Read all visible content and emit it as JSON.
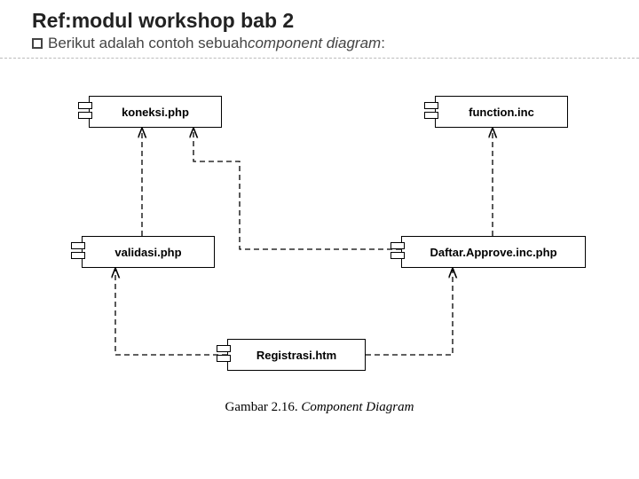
{
  "title": "Ref:modul workshop bab 2",
  "subtitle_prefix": "Berikut adalah contoh sebuah ",
  "subtitle_italic": "component diagram",
  "subtitle_suffix": " :",
  "caption_prefix": "Gambar 2.16. ",
  "caption_italic": "Component Diagram",
  "components": {
    "koneksi": "koneksi.php",
    "function": "function.inc",
    "validasi": "validasi.php",
    "daftar": "Daftar.Approve.inc.php",
    "registrasi": "Registrasi.htm"
  },
  "dependencies": [
    {
      "from": "validasi",
      "to": "koneksi"
    },
    {
      "from": "daftar",
      "to": "koneksi"
    },
    {
      "from": "daftar",
      "to": "function"
    },
    {
      "from": "registrasi",
      "to": "validasi"
    },
    {
      "from": "registrasi",
      "to": "daftar"
    }
  ]
}
